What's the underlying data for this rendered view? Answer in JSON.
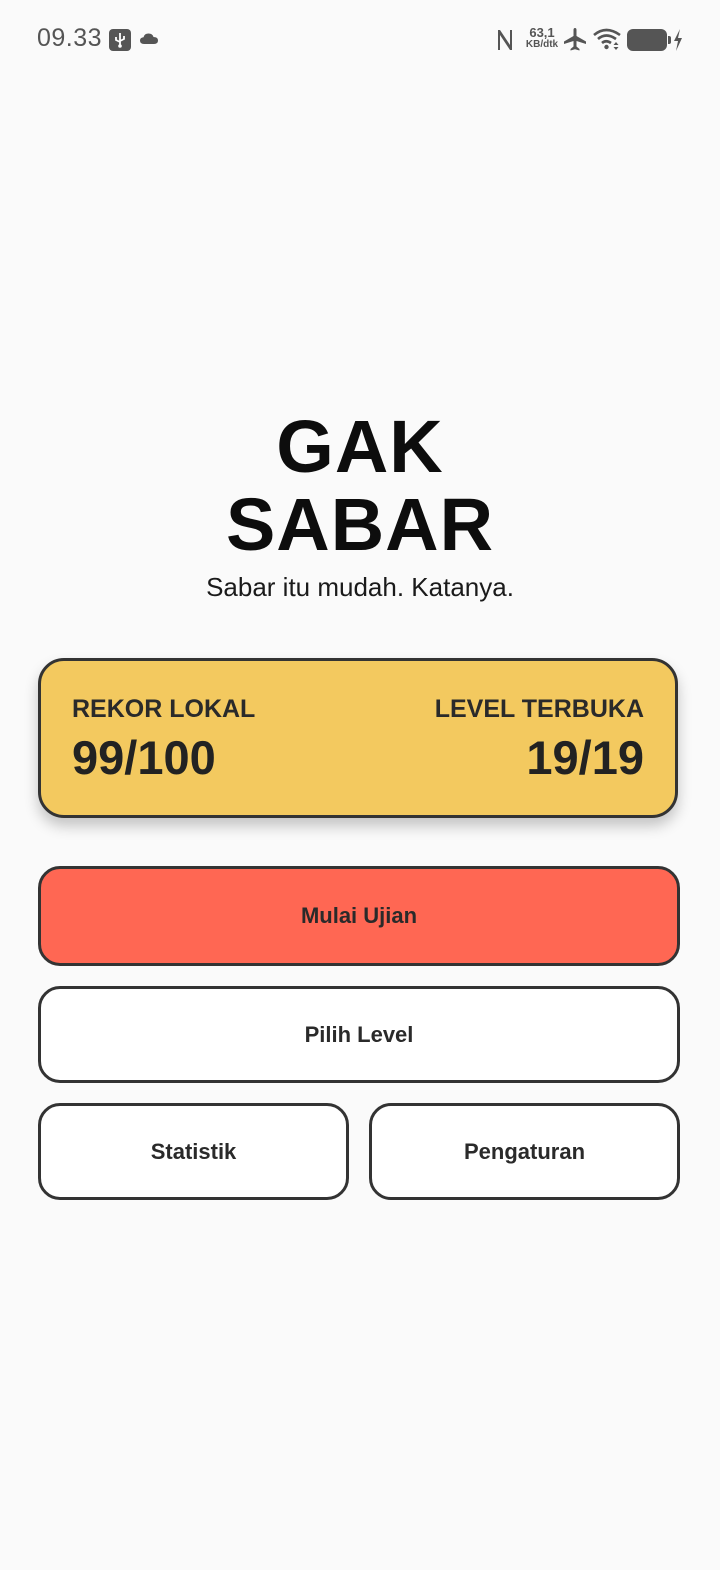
{
  "status_bar": {
    "time": "09.33",
    "net_speed_value": "63,1",
    "net_speed_unit": "KB/dtk",
    "icons": [
      "usb-icon",
      "cloud-icon",
      "nfc-icon",
      "airplane-mode-icon",
      "wifi-icon",
      "battery-icon",
      "charging-icon"
    ]
  },
  "header": {
    "title_line1": "GAK",
    "title_line2": "SABAR",
    "subtitle": "Sabar itu mudah. Katanya."
  },
  "record_card": {
    "left_label": "REKOR LOKAL",
    "left_value": "99/100",
    "right_label": "LEVEL TERBUKA",
    "right_value": "19/19"
  },
  "buttons": {
    "start": "Mulai Ujian",
    "choose_level": "Pilih Level",
    "statistics": "Statistik",
    "settings": "Pengaturan"
  },
  "colors": {
    "background": "#fafafa",
    "card": "#f3c95f",
    "primary_button": "#ff6753",
    "border": "#333333"
  }
}
